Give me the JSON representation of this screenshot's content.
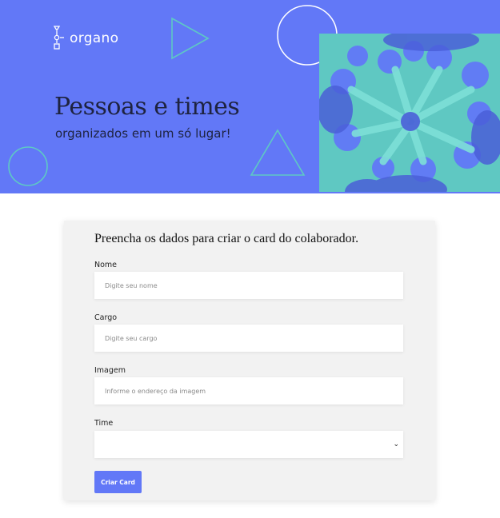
{
  "brand": {
    "name": "organo",
    "accent": "#6278f7",
    "highlight": "#5ec9c4"
  },
  "banner": {
    "headline": "Pessoas e times",
    "subhead": "organizados em um só lugar!",
    "photo_icon": "team-hands-photo"
  },
  "form": {
    "title": "Preencha os dados para criar o card do colaborador.",
    "fields": [
      {
        "label": "Nome",
        "placeholder": "Digite seu nome"
      },
      {
        "label": "Cargo",
        "placeholder": "Digite seu cargo"
      },
      {
        "label": "Imagem",
        "placeholder": "Informe o endereço da imagem"
      }
    ],
    "team_field": {
      "label": "Time",
      "selected": "",
      "icon": "chevron-down-icon"
    },
    "submit_label": "Criar Card"
  }
}
